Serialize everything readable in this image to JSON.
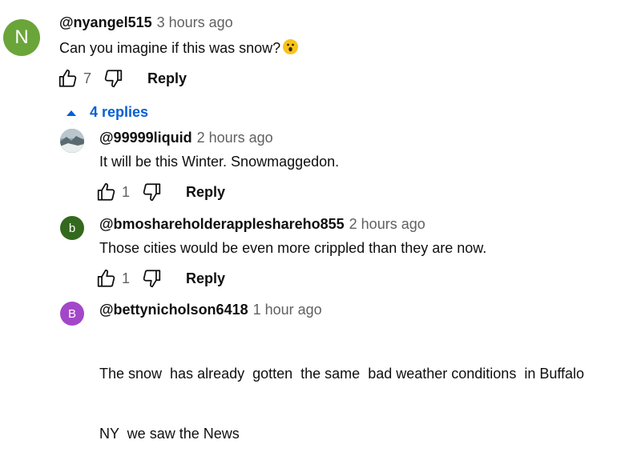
{
  "comment": {
    "avatar_letter": "N",
    "avatar_color": "#6aa53a",
    "author": "@nyangel515",
    "time": "3 hours ago",
    "text": "Can you imagine if this was snow?",
    "emoji": "astonished-face-emoji",
    "likes": "7",
    "reply_label": "Reply"
  },
  "replies_toggle": {
    "label": "4 replies",
    "icon": "caret-up-icon",
    "color": "#065fd4"
  },
  "replies": [
    {
      "avatar_type": "photo",
      "author": "@99999liquid",
      "time": "2 hours ago",
      "text": "It will be this Winter. Snowmaggedon.",
      "likes": "1",
      "reply_label": "Reply"
    },
    {
      "avatar_letter": "b",
      "avatar_color": "#33691e",
      "author": "@bmoshareholderappleshareho855",
      "time": "2 hours ago",
      "text": "Those cities would be even more crippled than they are now.",
      "likes": "1",
      "reply_label": "Reply"
    },
    {
      "avatar_letter": "B",
      "avatar_color": "#a347c9",
      "author": "@bettynicholson6418",
      "time": "1 hour ago",
      "text_line1": "The snow  has already  gotten  the same  bad weather conditions  in Buffalo",
      "text_line2": "NY  we saw the News"
    }
  ]
}
